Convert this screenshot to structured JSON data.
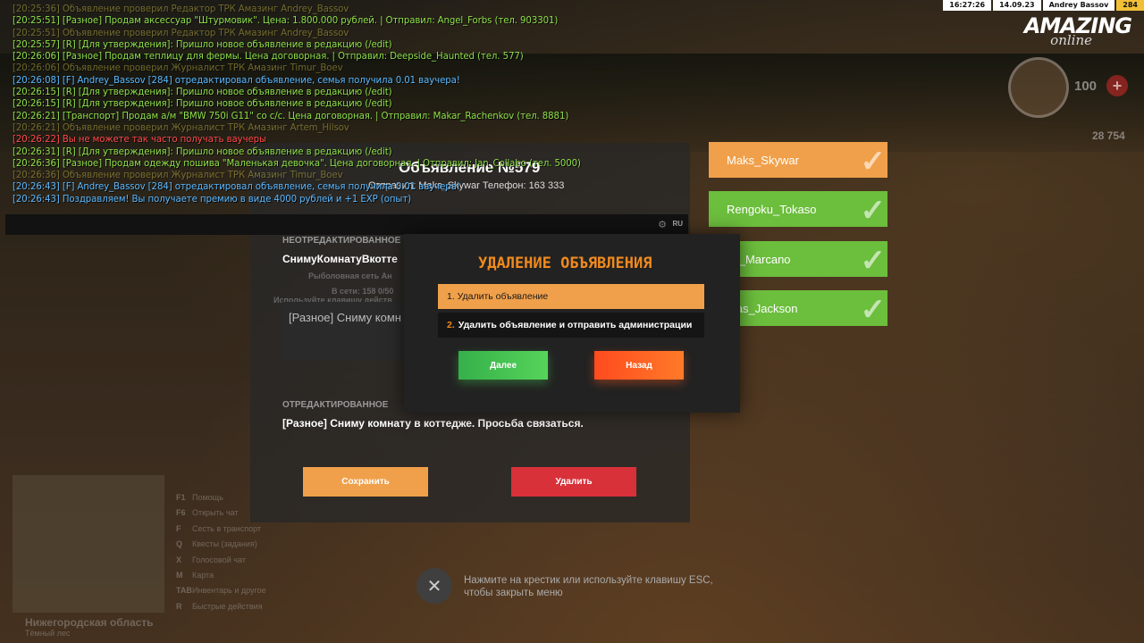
{
  "hud": {
    "time": "16:27:26",
    "date": "14.09.23",
    "player": "Andrey Bassov",
    "level": "284",
    "logo_main": "AMAZING",
    "logo_sub": "online",
    "hp": "100",
    "hp_plus": "+",
    "money": "28 754"
  },
  "chat": {
    "lines": [
      {
        "text": "[20:25:36] Объявление проверил Редактор ТРК Амазинг Andrey_Bassov",
        "color": "#d7c64a",
        "faded": true
      },
      {
        "text": "[20:25:51] [Разное] Продам аксессуар \"Штурмовик\". Цена: 1.800.000 рублей. | Отправил: Angel_Forbs (тел. 903301)",
        "color": "#8fe04a",
        "faded": false
      },
      {
        "text": "[20:25:51] Объявление проверил Редактор ТРК Амазинг Andrey_Bassov",
        "color": "#d7c64a",
        "faded": true
      },
      {
        "text": "[20:25:57] [R] [Для утверждения]: Пришло новое объявление в редакцию (/edit)",
        "color": "#8fe04a",
        "faded": false
      },
      {
        "text": "[20:26:06] [Разное] Продам теплицу для фермы. Цена договорная. | Отправил: Deepside_Haunted (тел. 577)",
        "color": "#8fe04a",
        "faded": false
      },
      {
        "text": "[20:26:06] Объявление проверил Журналист ТРК Амазинг Timur_Boev",
        "color": "#d7c64a",
        "faded": true
      },
      {
        "text": "[20:26:08] [F] Andrey_Bassov [284] отредактировал объявление, семья получила 0.01 ваучера!",
        "color": "#5ab8ff",
        "faded": false
      },
      {
        "text": "[20:26:15] [R] [Для утверждения]: Пришло новое объявление в редакцию (/edit)",
        "color": "#8fe04a",
        "faded": false
      },
      {
        "text": "[20:26:15] [R] [Для утверждения]: Пришло новое объявление в редакцию (/edit)",
        "color": "#8fe04a",
        "faded": false
      },
      {
        "text": "[20:26:21] [Транспорт] Продам а/м \"BMW 750i G11\" со с/с. Цена договорная. | Отправил: Makar_Rachenkov (тел. 8881)",
        "color": "#8fe04a",
        "faded": false
      },
      {
        "text": "[20:26:21] Объявление проверил Журналист ТРК Амазинг Artem_Hilsov",
        "color": "#d7c64a",
        "faded": true
      },
      {
        "text": "[20:26:22] Вы не можете так часто получать ваучеры",
        "color": "#ff4a4a",
        "faded": false
      },
      {
        "text": "[20:26:31] [R] [Для утверждения]: Пришло новое объявление в редакцию (/edit)",
        "color": "#8fe04a",
        "faded": false
      },
      {
        "text": "[20:26:36] [Разное] Продам одежду пошива \"Маленькая девочка\". Цена договорная. | Отправил: Jan_Collabo (тел. 5000)",
        "color": "#8fe04a",
        "faded": false
      },
      {
        "text": "[20:26:36] Объявление проверил Журналист ТРК Амазинг Timur_Boev",
        "color": "#d7c64a",
        "faded": true
      },
      {
        "text": "[20:26:43] [F] Andrey_Bassov [284] отредактировал объявление, семья получила 0.01 ваучера!",
        "color": "#5ab8ff",
        "faded": false
      },
      {
        "text": "[20:26:43] Поздравляем! Вы получаете премию в виде 4000 рублей и +1 EXP (опыт)",
        "color": "#5ab8ff",
        "faded": false
      }
    ],
    "lang": "RU"
  },
  "ad": {
    "title": "Объявление №579",
    "sender": "Отправил: Maks_Skywar Телефон: 163 333",
    "unedited_label": "НЕОТРЕДАКТИРОВАННОЕ",
    "unedited_text": "СнимуКомнатуВкотте",
    "station_line": "Рыболовная сеть Ан",
    "online_line": "В сети: 158 0/50",
    "hint_line": "Используйте клавишу действ",
    "input_value": "[Разное] Сниму комн",
    "edited_label": "ОТРЕДАКТИРОВАННОЕ",
    "edited_text": "[Разное] Сниму комнату в коттедже. Просьба связаться.",
    "save_label": "Сохранить",
    "delete_label": "Удалить",
    "close_hint_1": "Нажмите на крестик или используйте клавишу ESC,",
    "close_hint_2": "чтобы закрыть меню",
    "close_icon": "✕"
  },
  "editors": [
    {
      "name": "Maks_Skywar",
      "color": "orange"
    },
    {
      "name": "Rengoku_Tokaso",
      "color": "green"
    },
    {
      "name": "zo_Marcano",
      "color": "green"
    },
    {
      "name": "mas_Jackson",
      "color": "green"
    }
  ],
  "hotkeys": [
    {
      "key": "F1",
      "label": "Помощь"
    },
    {
      "key": "F6",
      "label": "Открыть чат"
    },
    {
      "key": "F",
      "label": "Сесть в транспорт"
    },
    {
      "key": "Q",
      "label": "Квесты (задания)"
    },
    {
      "key": "X",
      "label": "Голосовой чат"
    },
    {
      "key": "M",
      "label": "Карта"
    },
    {
      "key": "TAB",
      "label": "Инвентарь и другое"
    },
    {
      "key": "R",
      "label": "Быстрые действия"
    }
  ],
  "region": {
    "name": "Нижегородская область",
    "sub": "Тёмный лес"
  },
  "modal": {
    "title": "УДАЛЕНИЕ ОБЪЯВЛЕНИЯ",
    "option1": "1. Удалить объявление",
    "option2_num": "2.",
    "option2": "Удалить объявление и отправить администрации",
    "next_label": "Далее",
    "back_label": "Назад"
  }
}
